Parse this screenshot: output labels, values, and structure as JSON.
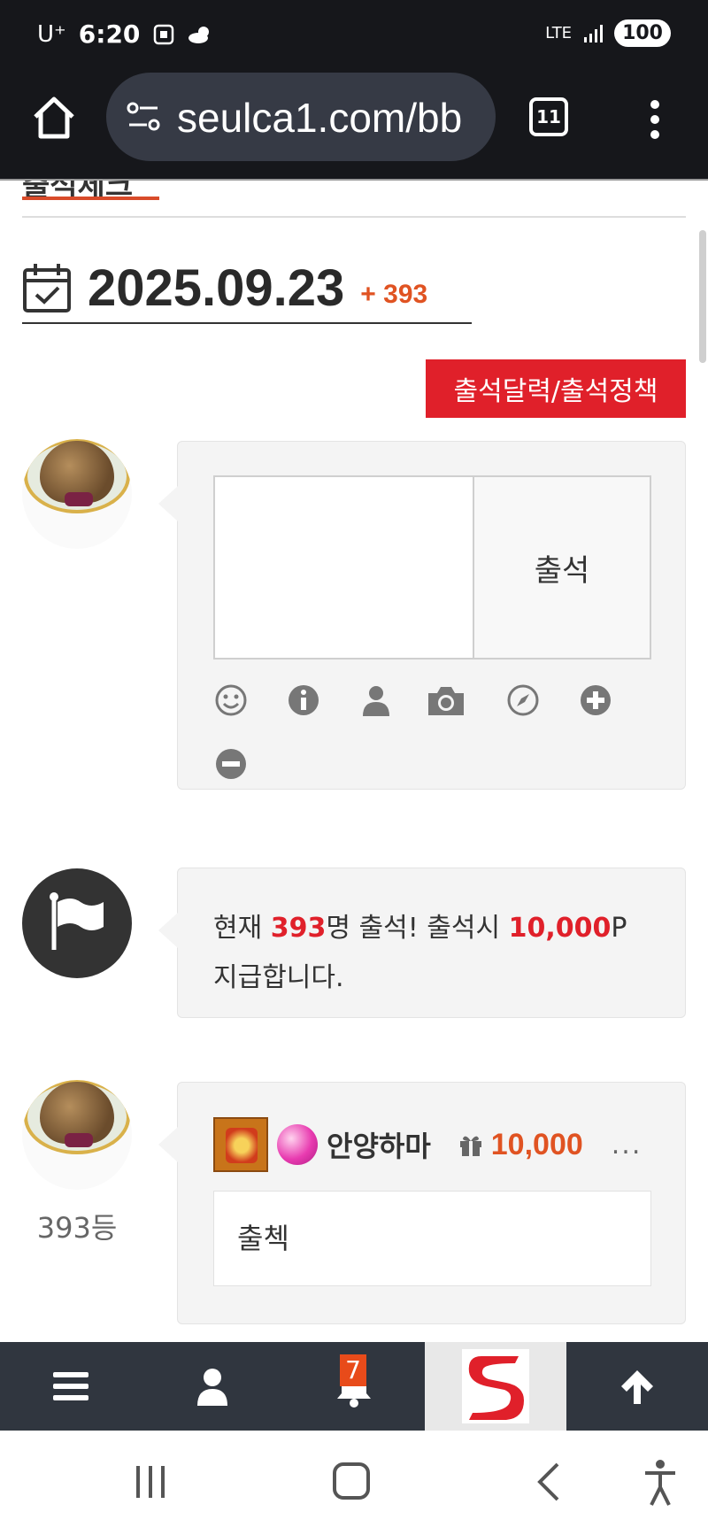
{
  "status": {
    "carrier": "U⁺",
    "time": "6:20",
    "network": "LTE",
    "battery": "100"
  },
  "browser": {
    "url": "seulca1.com/bb",
    "tab_count": "11"
  },
  "page": {
    "tab_title": "출석체크",
    "date": "2025.09.23",
    "count_label": "+ 393",
    "policy_button": "출석달력/출석정책",
    "submit_label": "출석",
    "notice": {
      "prefix": "현재 ",
      "count": "393",
      "middle": "명 출석! 출석시 ",
      "points": "10,000",
      "suffix": "P",
      "line2": "지급합니다."
    },
    "entry": {
      "rank": "393등",
      "user_name": "안양하마",
      "points": "10,000",
      "more": "...",
      "comment": "출첵"
    },
    "toolbar_icons": [
      "smile-icon",
      "info-icon",
      "user-icon",
      "camera-icon",
      "compass-icon",
      "plus-icon",
      "minus-icon"
    ]
  },
  "bottom_nav": {
    "notification_count": "7"
  },
  "colors": {
    "accent_red": "#e0202a",
    "accent_orange": "#e05322",
    "dark_bar": "#16171b",
    "nav_bg": "#30363f"
  }
}
